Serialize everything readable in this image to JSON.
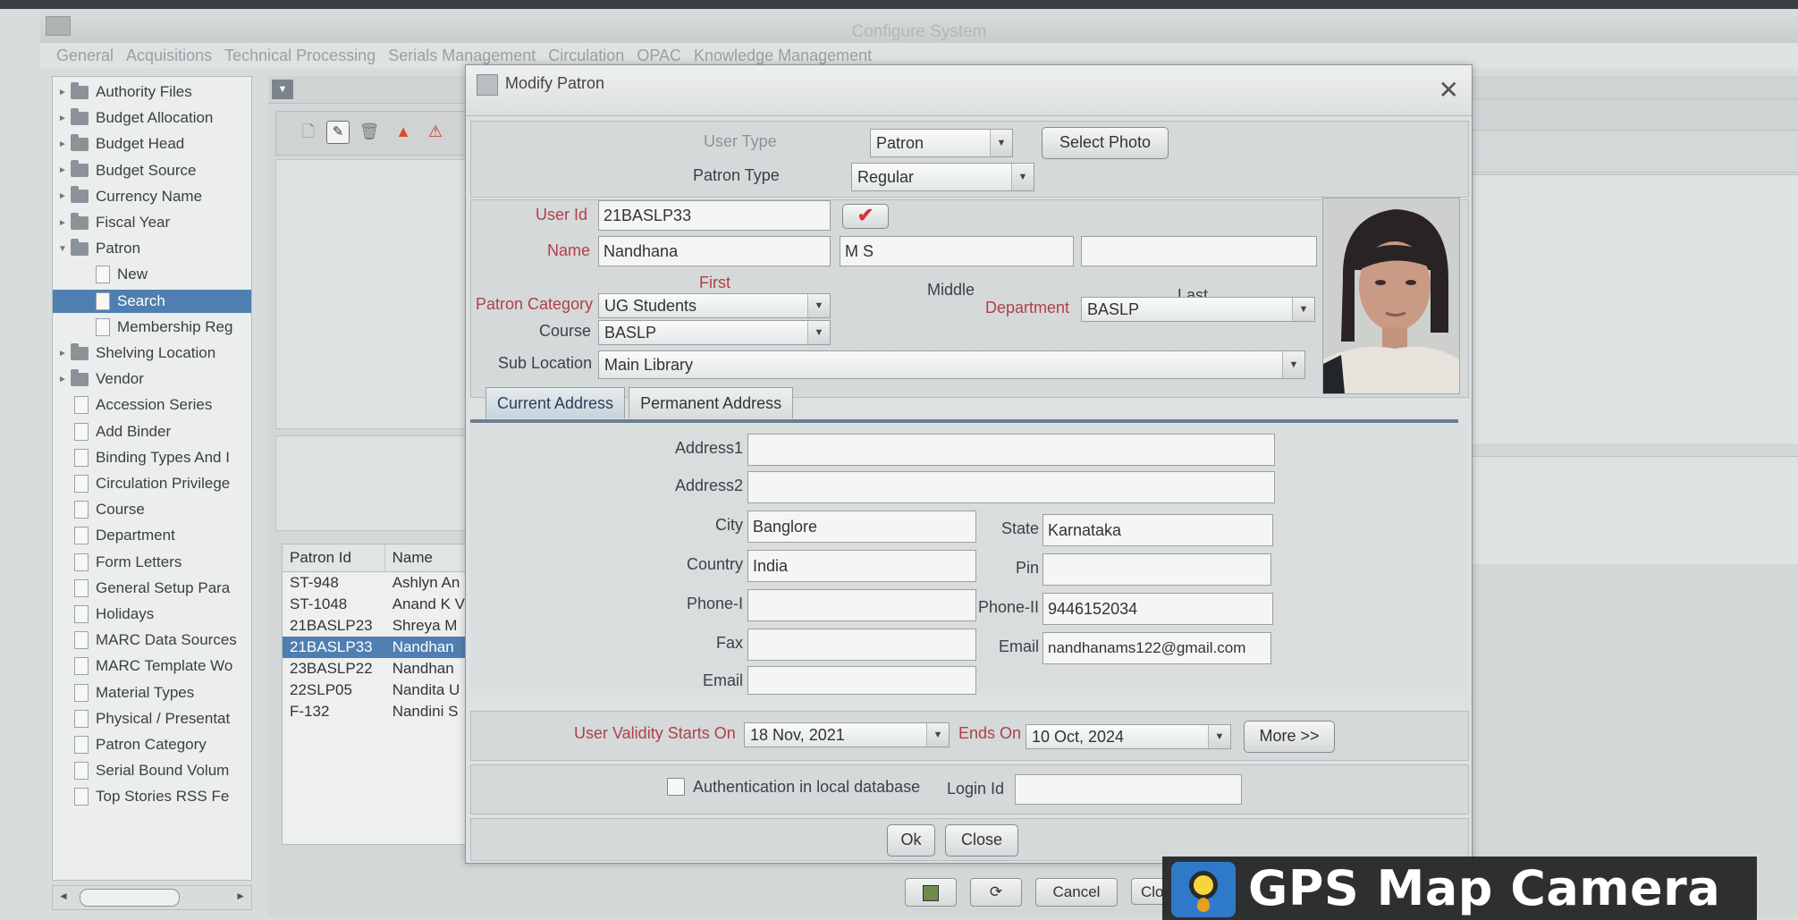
{
  "main_window": {
    "title": "Configure System",
    "menu": [
      "General",
      "Acquisitions",
      "Technical Processing",
      "Serials Management",
      "Circulation",
      "OPAC",
      "Knowledge Management"
    ]
  },
  "tree": {
    "items": [
      {
        "label": "Authority Files",
        "type": "folder",
        "expander": "►"
      },
      {
        "label": "Budget Allocation",
        "type": "folder",
        "expander": "►"
      },
      {
        "label": "Budget Head",
        "type": "folder",
        "expander": "►"
      },
      {
        "label": "Budget Source",
        "type": "folder",
        "expander": "►"
      },
      {
        "label": "Currency Name",
        "type": "folder",
        "expander": "►"
      },
      {
        "label": "Fiscal Year",
        "type": "folder",
        "expander": "►"
      },
      {
        "label": "Patron",
        "type": "folder",
        "expander": "▼"
      },
      {
        "label": "New",
        "type": "doc"
      },
      {
        "label": "Search",
        "type": "doc",
        "selected": true
      },
      {
        "label": "Membership Reg",
        "type": "doc"
      },
      {
        "label": "Shelving Location",
        "type": "folder",
        "expander": "►"
      },
      {
        "label": "Vendor",
        "type": "folder",
        "expander": "►"
      },
      {
        "label": "Accession Series",
        "type": "doc"
      },
      {
        "label": "Add Binder",
        "type": "doc"
      },
      {
        "label": "Binding Types And I",
        "type": "doc"
      },
      {
        "label": "Circulation Privilege",
        "type": "doc"
      },
      {
        "label": "Course",
        "type": "doc"
      },
      {
        "label": "Department",
        "type": "doc"
      },
      {
        "label": "Form Letters",
        "type": "doc"
      },
      {
        "label": "General Setup Para",
        "type": "doc"
      },
      {
        "label": "Holidays",
        "type": "doc"
      },
      {
        "label": "MARC Data Sources",
        "type": "doc"
      },
      {
        "label": "MARC Template Wo",
        "type": "doc"
      },
      {
        "label": "Material Types",
        "type": "doc"
      },
      {
        "label": "Physical / Presentat",
        "type": "doc"
      },
      {
        "label": "Patron Category",
        "type": "doc"
      },
      {
        "label": "Serial Bound Volum",
        "type": "doc"
      },
      {
        "label": "Top Stories RSS Fe",
        "type": "doc"
      }
    ]
  },
  "results_table": {
    "headers": [
      "Patron Id",
      "Name"
    ],
    "rows": [
      [
        "ST-948",
        "Ashlyn An"
      ],
      [
        "ST-1048",
        "Anand K V"
      ],
      [
        "21BASLP23",
        "Shreya M"
      ],
      [
        "21BASLP33",
        "Nandhan"
      ],
      [
        "23BASLP22",
        "Nandhan"
      ],
      [
        "22SLP05",
        "Nandita U"
      ],
      [
        "F-132",
        "Nandini S"
      ]
    ],
    "selected_row": 3
  },
  "bottom_buttons": {
    "cancel": "Cancel",
    "close_partial": "Clo"
  },
  "dialog": {
    "title": "Modify Patron",
    "close_glyph": "✕",
    "user_type_label": "User Type",
    "user_type_value": "Patron",
    "select_photo": "Select Photo",
    "patron_type_label": "Patron Type",
    "patron_type_value": "Regular",
    "user_id_label": "User Id",
    "user_id_value": "21BASLP33",
    "check_mark": "✔",
    "name_label": "Name",
    "first_name": "Nandhana",
    "middle_name": "M S",
    "last_name": "",
    "first_caption": "First",
    "middle_caption": "Middle",
    "last_caption": "Last",
    "patron_category_label": "Patron Category",
    "patron_category_value": "UG Students",
    "department_label": "Department",
    "department_value": "BASLP",
    "course_label": "Course",
    "course_value": "BASLP",
    "sub_location_label": "Sub Location",
    "sub_location_value": "Main Library",
    "tabs": [
      "Current Address",
      "Permanent Address"
    ],
    "address": {
      "address1_label": "Address1",
      "address1_value": "",
      "address2_label": "Address2",
      "address2_value": "",
      "city_label": "City",
      "city_value": "Banglore",
      "state_label": "State",
      "state_value": "Karnataka",
      "country_label": "Country",
      "country_value": "India",
      "pin_label": "Pin",
      "pin_value": "",
      "phone1_label": "Phone-I",
      "phone1_value": "",
      "phone2_label": "Phone-II",
      "phone2_value": "9446152034",
      "fax_label": "Fax",
      "fax_value": "",
      "email_right_label": "Email",
      "email_right_value": "nandhanams122@gmail.com",
      "email_left_label": "Email",
      "email_left_value": ""
    },
    "validity_label": "User Validity Starts On",
    "validity_start": "18 Nov, 2021",
    "ends_on_label": "Ends On",
    "validity_end": "10 Oct, 2024",
    "more_button": "More >>",
    "auth_label": "Authentication in local database",
    "login_id_label": "Login Id",
    "login_id_value": "",
    "ok_button": "Ok",
    "close_button": "Close"
  },
  "watermark": {
    "text": "GPS Map Camera"
  }
}
